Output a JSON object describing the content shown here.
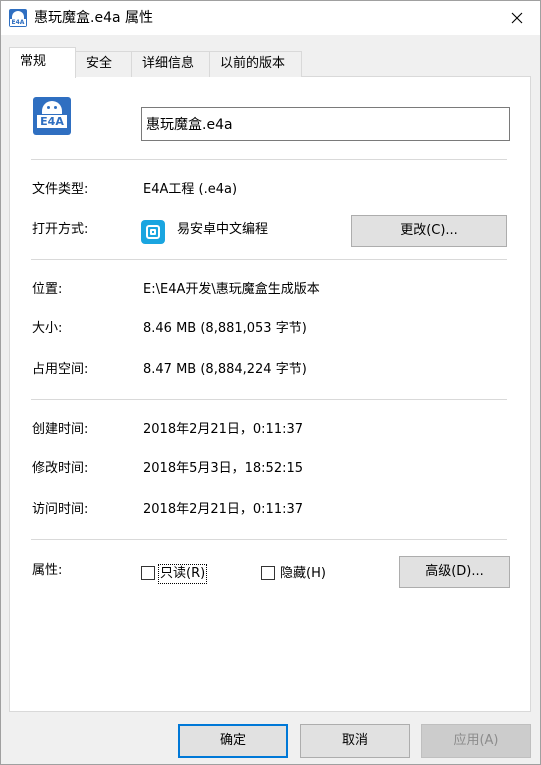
{
  "window": {
    "title": "惠玩魔盒.e4a 属性",
    "icon": "e4a-file-icon",
    "icon_text": "E4A"
  },
  "tabs": [
    {
      "label": "常规",
      "active": true
    },
    {
      "label": "安全",
      "active": false
    },
    {
      "label": "详细信息",
      "active": false
    },
    {
      "label": "以前的版本",
      "active": false
    }
  ],
  "general": {
    "filename": "惠玩魔盒.e4a",
    "file_type_label": "文件类型:",
    "file_type_value": "E4A工程 (.e4a)",
    "open_with_label": "打开方式:",
    "open_with_value": "易安卓中文编程",
    "change_button": "更改(C)...",
    "location_label": "位置:",
    "location_value": "E:\\E4A开发\\惠玩魔盒生成版本",
    "size_label": "大小:",
    "size_value": "8.46 MB (8,881,053 字节)",
    "size_on_disk_label": "占用空间:",
    "size_on_disk_value": "8.47 MB (8,884,224 字节)",
    "created_label": "创建时间:",
    "created_value": "2018年2月21日，0:11:37",
    "modified_label": "修改时间:",
    "modified_value": "2018年5月3日，18:52:15",
    "accessed_label": "访问时间:",
    "accessed_value": "2018年2月21日，0:11:37",
    "attributes_label": "属性:",
    "readonly_label": "只读(R)",
    "readonly_checked": false,
    "hidden_label": "隐藏(H)",
    "hidden_checked": false,
    "advanced_button": "高级(D)..."
  },
  "footer": {
    "ok": "确定",
    "cancel": "取消",
    "apply": "应用(A)"
  },
  "colors": {
    "accent": "#0078d7",
    "icon_blue": "#2f6fc1",
    "app_icon": "#1aa5e0"
  }
}
